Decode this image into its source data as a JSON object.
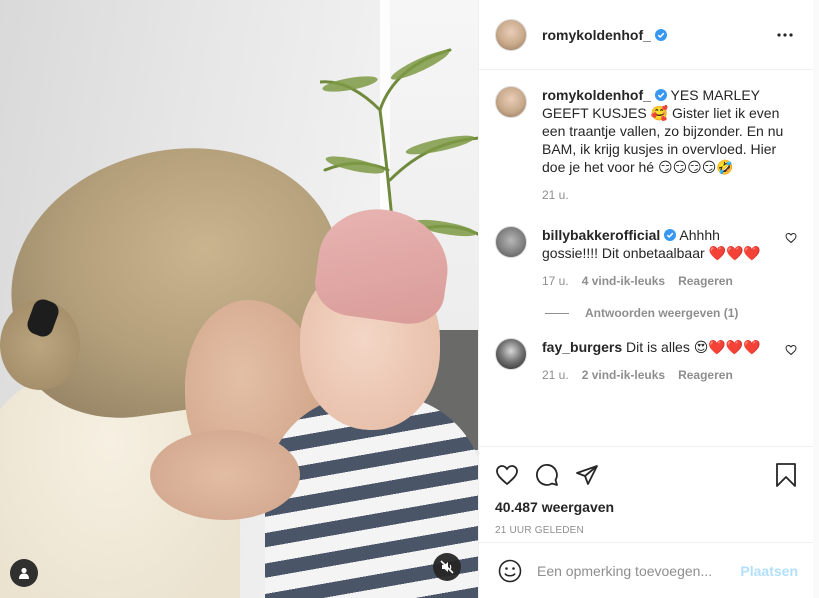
{
  "post": {
    "author": "romykoldenhof_",
    "verified": true,
    "caption": {
      "user": "romykoldenhof_",
      "text": "YES MARLEY GEEFT KUSJES 🥰 Gister liet ik even een traantje vallen, zo bijzonder. En nu BAM, ik krijg kusjes in overvloed. Hier doe je het voor hé 😏😏😏😏🤣",
      "time": "21 u."
    },
    "comments": [
      {
        "user": "billybakkerofficial",
        "verified": true,
        "text": "Ahhhh gossie!!!! Dit onbetaalbaar ❤️❤️❤️",
        "time": "17 u.",
        "likes": "4 vind-ik-leuks",
        "reply_label": "Reageren",
        "view_replies": "Antwoorden weergeven (1)"
      },
      {
        "user": "fay_burgers",
        "verified": false,
        "text": "Dit is alles 😍❤️❤️❤️",
        "time": "21 u.",
        "likes": "2 vind-ik-leuks",
        "reply_label": "Reageren"
      }
    ],
    "views": "40.487 weergaven",
    "posted": "21 UUR GELEDEN"
  },
  "add_comment": {
    "placeholder": "Een opmerking toevoegen...",
    "post_label": "Plaatsen"
  },
  "icons": {
    "like": "heart-icon",
    "comment": "comment-bubble-icon",
    "share": "paper-plane-icon",
    "save": "bookmark-icon",
    "more": "more-dots-icon",
    "mute": "speaker-muted-icon",
    "tags": "user-tag-icon",
    "emoji": "emoji-icon",
    "verified": "verified-badge-icon"
  },
  "colors": {
    "verified_blue": "#3897f0",
    "post_button_disabled": "#b2dffc",
    "muted_text": "#8e8e8e"
  }
}
